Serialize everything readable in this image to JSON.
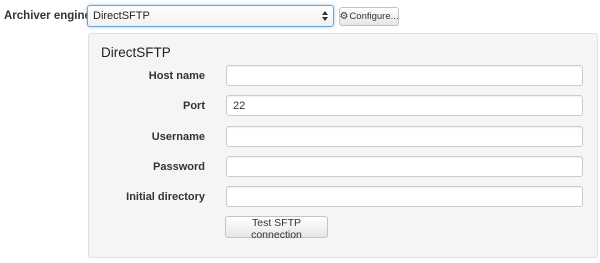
{
  "archiver": {
    "label": "Archiver engine",
    "selected_engine": "DirectSFTP",
    "configure_label": "Configure..."
  },
  "panel": {
    "title": "DirectSFTP",
    "fields": [
      {
        "label": "Host name",
        "value": "",
        "placeholder": ""
      },
      {
        "label": "Port",
        "value": "22",
        "placeholder": ""
      },
      {
        "label": "Username",
        "value": "",
        "placeholder": ""
      },
      {
        "label": "Password",
        "value": "",
        "placeholder": ""
      },
      {
        "label": "Initial directory",
        "value": "",
        "placeholder": ""
      }
    ],
    "test_button_label": "Test SFTP connection"
  },
  "colors": {
    "focus_border": "#6fa0d6",
    "panel_background": "#f5f5f5",
    "input_border": "#cccccc"
  }
}
